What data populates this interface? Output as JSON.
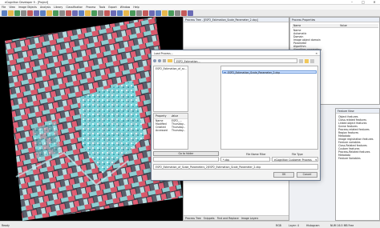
{
  "window": {
    "title": "eCognition Developer 9 - [Project]",
    "min_glyph": "–",
    "max_glyph": "□",
    "close_glyph": "✕"
  },
  "menu": [
    "File",
    "View",
    "Image Objects",
    "Analysis",
    "Library",
    "Classification",
    "Process",
    "Tools",
    "Export",
    "Window",
    "Help"
  ],
  "toolbar": {
    "icons": [
      "new-icon",
      "open-icon",
      "save-icon",
      "zoom-icon",
      "pan-icon",
      "select-icon",
      "layer-icon",
      "view-icon",
      "settings-icon",
      "tool-icon",
      "tool-icon",
      "tool-icon",
      "tool-icon",
      "tool-icon",
      "tool-icon",
      "tool-icon",
      "tool-icon",
      "tool-icon",
      "tool-icon",
      "tool-icon",
      "tool-icon",
      "tool-icon",
      "tool-icon",
      "tool-icon",
      "tool-icon",
      "tool-icon",
      "tool-icon",
      "tool-icon",
      "tool-icon",
      "tool-icon"
    ]
  },
  "process_tree": {
    "title": "Process Tree - [ESP2_Estimation_Scale_Parameter_2.dcp]",
    "bottom_tabs": [
      "Process Tree",
      "Snippets",
      "Find and Replace",
      "Image Layers"
    ]
  },
  "process_properties": {
    "title": "Process Properties",
    "columns": [
      "Name",
      "Value"
    ],
    "rows": [
      "Name",
      "Automatic",
      "Domain",
      "Image object domain",
      "Parameter",
      "Algorithm",
      "Algorithm parameters"
    ]
  },
  "feature_view": {
    "title": "Feature View",
    "items": [
      "Object features",
      "Class-related features",
      "Linked object features",
      "Scene features",
      "Process-related features",
      "Region features",
      "Metadata",
      "Image registration features",
      "Feature variables",
      "Class-Related features",
      "Custom features",
      "Process-Related features",
      "Metadata",
      "Feature Variables"
    ]
  },
  "dialog": {
    "title": "Load Process...",
    "close_glyph": "✕",
    "path": "ESP2_Estimation...",
    "sidebar_item": "ESP2_Estimation_of_sc...",
    "file_selected": "ESP2_Estimation_Scale_Parameter_2.dcp",
    "props_columns": [
      "Property",
      "Value"
    ],
    "props_rows": [
      [
        "Name",
        "ESP2_..."
      ],
      [
        "Modified",
        "Thursday..."
      ],
      [
        "Created",
        "Thursday..."
      ],
      [
        "Accessed",
        "Thursday..."
      ]
    ],
    "go_to_folder": "Go to folder",
    "file_name_filter_label": "File Name Filter",
    "file_name_filter": "*.dcp",
    "file_type_label": "File Type",
    "file_type": "eCognition Customer Process",
    "path_value": "ESP2_Estimation_of_Scale_Parameters_2\\ESP2_Estimation_Scale_Parameter_2.dcp",
    "open_label": "OK",
    "cancel_label": "Cancel"
  },
  "status": {
    "ready": "Ready",
    "rgb": "RGB",
    "layer": "Layer: 4",
    "histogram": "Histogram",
    "zoom": "NUM   16.5 MB Free"
  }
}
